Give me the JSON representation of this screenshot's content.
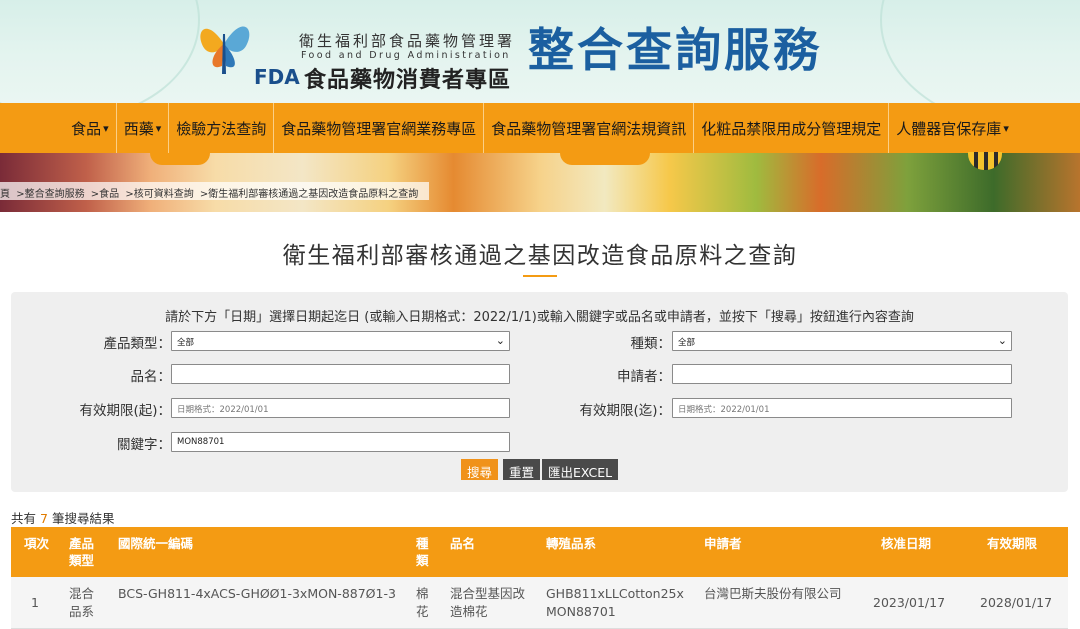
{
  "header": {
    "gov_cn": "衛生福利部食品藥物管理署",
    "gov_en": "Food and Drug Administration",
    "fda": "FDA",
    "fda_cn": "食品藥物消費者專區",
    "service_title": "整合查詢服務"
  },
  "nav": {
    "items": [
      {
        "label": "食品",
        "caret": "▾"
      },
      {
        "label": "西藥",
        "caret": "▾"
      },
      {
        "label": "檢驗方法查詢",
        "caret": ""
      },
      {
        "label": "食品藥物管理署官網業務專區",
        "caret": ""
      },
      {
        "label": "食品藥物管理署官網法規資訊",
        "caret": ""
      },
      {
        "label": "化粧品禁限用成分管理規定",
        "caret": ""
      },
      {
        "label": "人體器官保存庫",
        "caret": "▾"
      }
    ]
  },
  "breadcrumb": {
    "items": [
      "頁",
      ">整合查詢服務",
      ">食品",
      ">核可資料查詢",
      ">衛生福利部審核通過之基因改造食品原料之查詢"
    ]
  },
  "page_title": "衛生福利部審核通過之基因改造食品原料之查詢",
  "search": {
    "instruction": "請於下方「日期」選擇日期起迄日 (或輸入日期格式：2022/1/1)或輸入關鍵字或品名或申請者，並按下「搜尋」按鈕進行內容查詢",
    "product_type_label": "產品類型：",
    "product_type_value": "全部",
    "category_label": "種類：",
    "category_value": "全部",
    "name_label": "品名：",
    "name_value": "",
    "applicant_label": "申請者：",
    "applicant_value": "",
    "valid_from_label": "有效期限(起)：",
    "valid_from_placeholder": "日期格式：2022/01/01",
    "valid_to_label": "有效期限(迄)：",
    "valid_to_placeholder": "日期格式：2022/01/01",
    "keyword_label": "關鍵字：",
    "keyword_value": "MON88701",
    "search_button": "搜尋",
    "reset_button": "重置",
    "export_button": "匯出EXCEL",
    "dropdown_icon": "chevron-down-icon"
  },
  "results": {
    "count_prefix": "共有",
    "count": "7",
    "count_suffix": "筆搜尋結果",
    "columns": [
      "項次",
      "產品類型",
      "國際統一編碼",
      "種類",
      "品名",
      "轉殖品系",
      "申請者",
      "核准日期",
      "有效期限"
    ],
    "rows": [
      {
        "index": "1",
        "product_type": "混合品系",
        "code": "BCS-GH811-4xACS-GHØØ1-3xMON-887Ø1-3",
        "category": "棉花",
        "name": "混合型基因改造棉花",
        "strain": "GHB811xLLCotton25xMON88701",
        "applicant": "台灣巴斯夫股份有限公司",
        "approval_date": "2023/01/17",
        "expiry_date": "2028/01/17"
      }
    ]
  },
  "colors": {
    "accent": "#f49b13",
    "title_blue": "#1b5fa0",
    "count_orange": "#e07b00"
  }
}
